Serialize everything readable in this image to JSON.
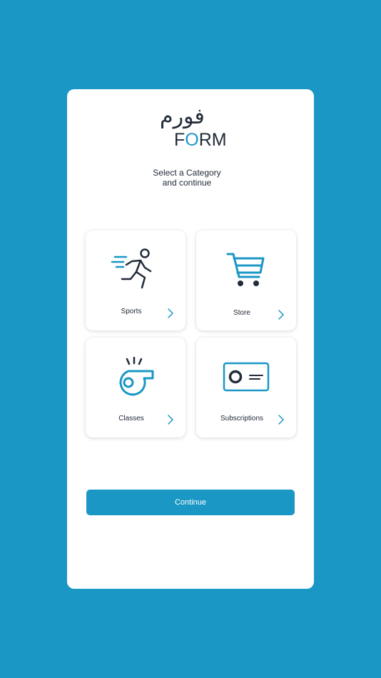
{
  "brand": {
    "arabic": "فورم",
    "latin_prefix": "F",
    "latin_accent": "O",
    "latin_suffix": "RM",
    "accent_color": "#1a97c4",
    "dark_color": "#222b3a"
  },
  "subtitle": {
    "line1": "Select a Category",
    "line2": "and continue"
  },
  "categories": [
    {
      "label": "Sports",
      "icon": "running-person-icon"
    },
    {
      "label": "Store",
      "icon": "shopping-cart-icon"
    },
    {
      "label": "Classes",
      "icon": "whistle-icon"
    },
    {
      "label": "Subscriptions",
      "icon": "membership-card-icon"
    }
  ],
  "continue_label": "Continue",
  "background_color": "#1a97c4"
}
